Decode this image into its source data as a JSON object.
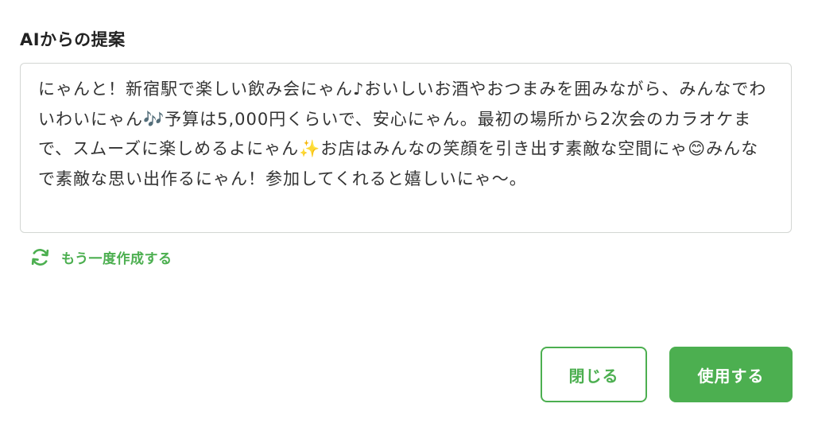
{
  "dialog": {
    "title": "AIからの提案",
    "proposal_text": "にゃんと！新宿駅で楽しい飲み会にゃん♪おいしいお酒やおつまみを囲みながら、みんなでわいわいにゃん🎶予算は5,000円くらいで、安心にゃん。最初の場所から2次会のカラオケまで、スムーズに楽しめるよにゃん✨お店はみんなの笑顔を引き出す素敵な空間にゃ😊みんなで素敵な思い出作るにゃん！参加してくれると嬉しいにゃ〜。",
    "regenerate": {
      "label": "もう一度作成する",
      "icon": "refresh-icon"
    },
    "buttons": {
      "close_label": "閉じる",
      "use_label": "使用する"
    }
  },
  "colors": {
    "accent": "#4caf50",
    "border": "#d3d6d3",
    "text": "#333333"
  }
}
